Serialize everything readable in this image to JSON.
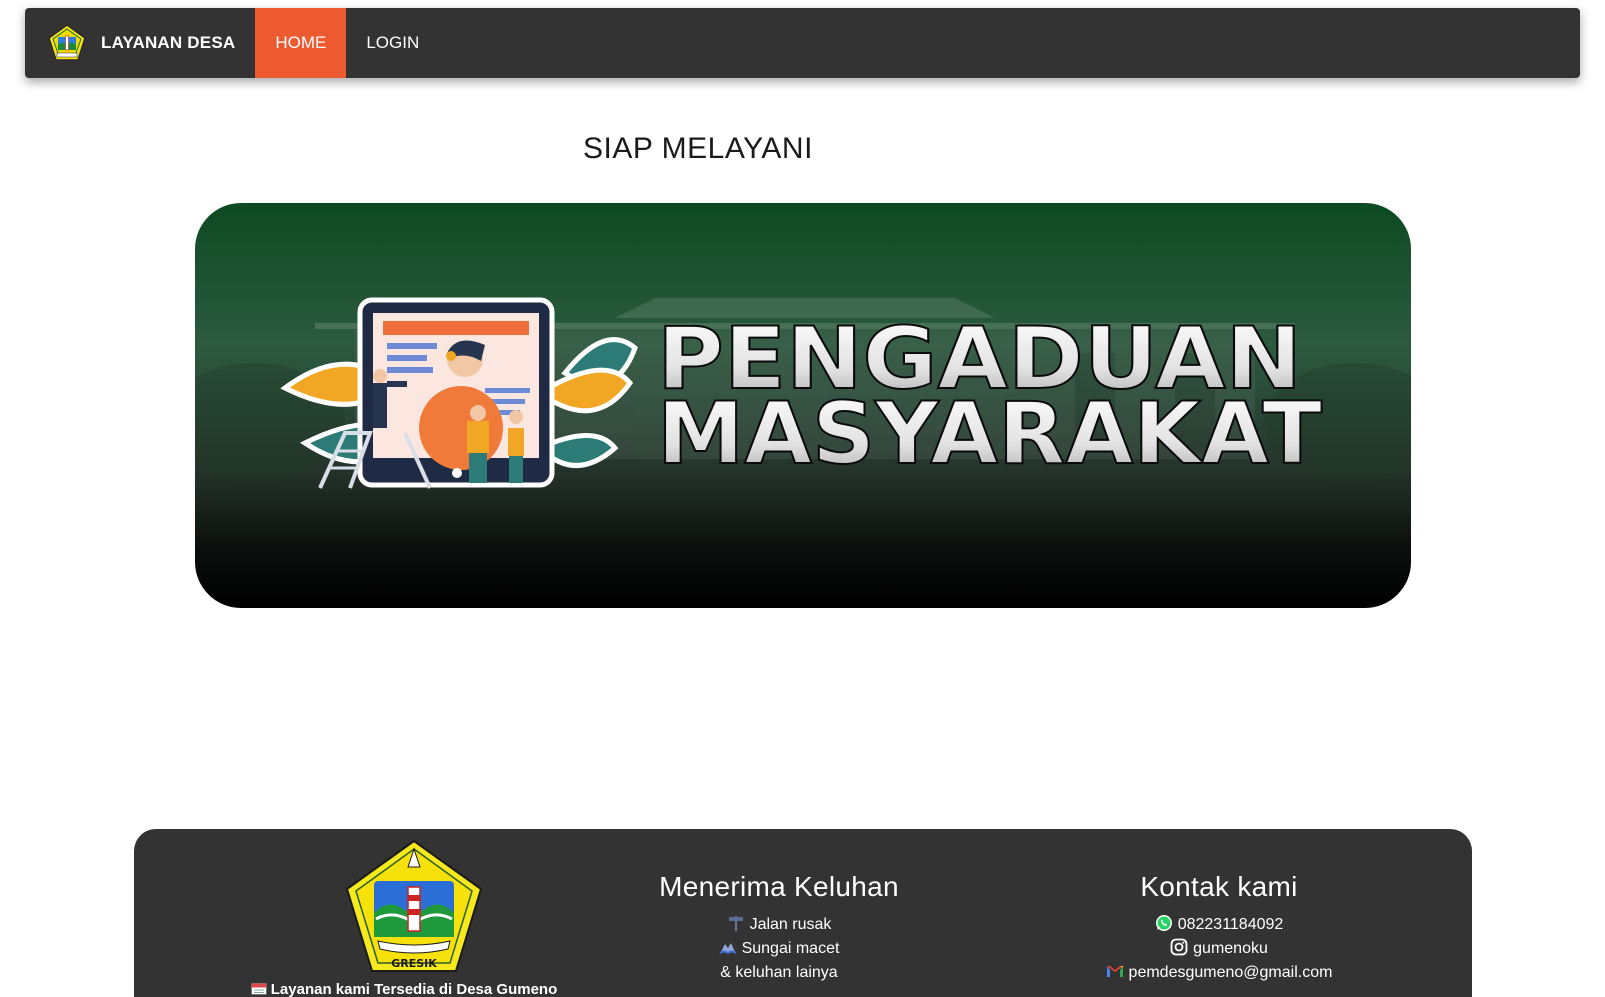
{
  "nav": {
    "brand": "LAYANAN DESA",
    "items": [
      {
        "label": "HOME",
        "active": true
      },
      {
        "label": "LOGIN",
        "active": false
      }
    ],
    "background": "#333333",
    "active_color": "#ee5a2f"
  },
  "main": {
    "heading": "SIAP MELAYANI",
    "banner": {
      "line1": "PENGADUAN",
      "line2": "MASYARAKAT"
    }
  },
  "footer": {
    "logo_text": "GRESIK",
    "tagline": "Layanan kami Tersedia di Desa Gumeno",
    "keluhan": {
      "title": "Menerima Keluhan",
      "items": [
        {
          "icon": "road-sign-icon",
          "label": "Jalan rusak"
        },
        {
          "icon": "flood-icon",
          "label": "Sungai macet"
        },
        {
          "icon": "",
          "label": "& keluhan lainya"
        }
      ]
    },
    "kontak": {
      "title": "Kontak kami",
      "items": [
        {
          "icon": "whatsapp-icon",
          "label": "082231184092"
        },
        {
          "icon": "instagram-icon",
          "label": "gumenoku"
        },
        {
          "icon": "gmail-icon",
          "label": "pemdesgumeno@gmail.com"
        }
      ]
    }
  }
}
